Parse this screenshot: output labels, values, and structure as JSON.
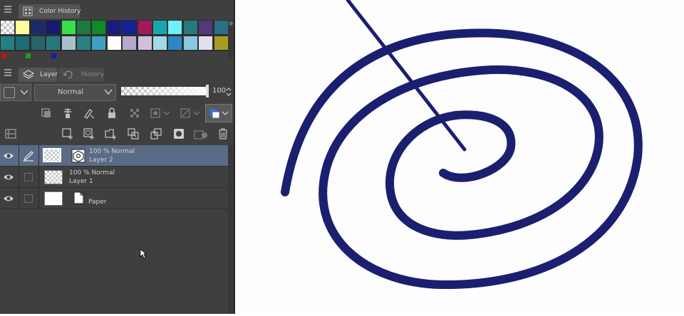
{
  "color_history_panel": {
    "tab_label": "Color History",
    "swatch_colors_row1": [
      "#fefc9c",
      "#1c2a6c",
      "#141a6e",
      "#36e04a",
      "#1d7a3e",
      "#108b2a",
      "#191b7e",
      "#142097",
      "#a21a5a",
      "#1aa6ad",
      "#6ef0f8",
      "#277a7c",
      "#55377e",
      "#2b6e88"
    ],
    "swatch_colors_row2": [
      "#247e82",
      "#1e6a78",
      "#2a6468",
      "#25797c",
      "#a8c0cc",
      "#2b7f82",
      "#3fa0c4",
      "#ffffff",
      "#b8a8cc",
      "#d0c0d8",
      "#a4d8e8",
      "#2b88c4",
      "#88c8e0",
      "#dfe0e8",
      "#a59c24"
    ],
    "mini_swatch_colors": [
      "#c81010",
      "#18a01e",
      "#1a1aa0"
    ]
  },
  "layer_panel": {
    "tab_layer": "Layer",
    "tab_history": "History",
    "blend_mode": "Normal",
    "opacity": "100",
    "layers": [
      {
        "mode": "100 % Normal",
        "name": "Layer 2",
        "selected": true
      },
      {
        "mode": "100 % Normal",
        "name": "Layer 1",
        "selected": false
      },
      {
        "mode": "",
        "name": "Paper",
        "selected": false
      }
    ]
  },
  "canvas": {
    "stroke_color": "#1b1f6f"
  }
}
